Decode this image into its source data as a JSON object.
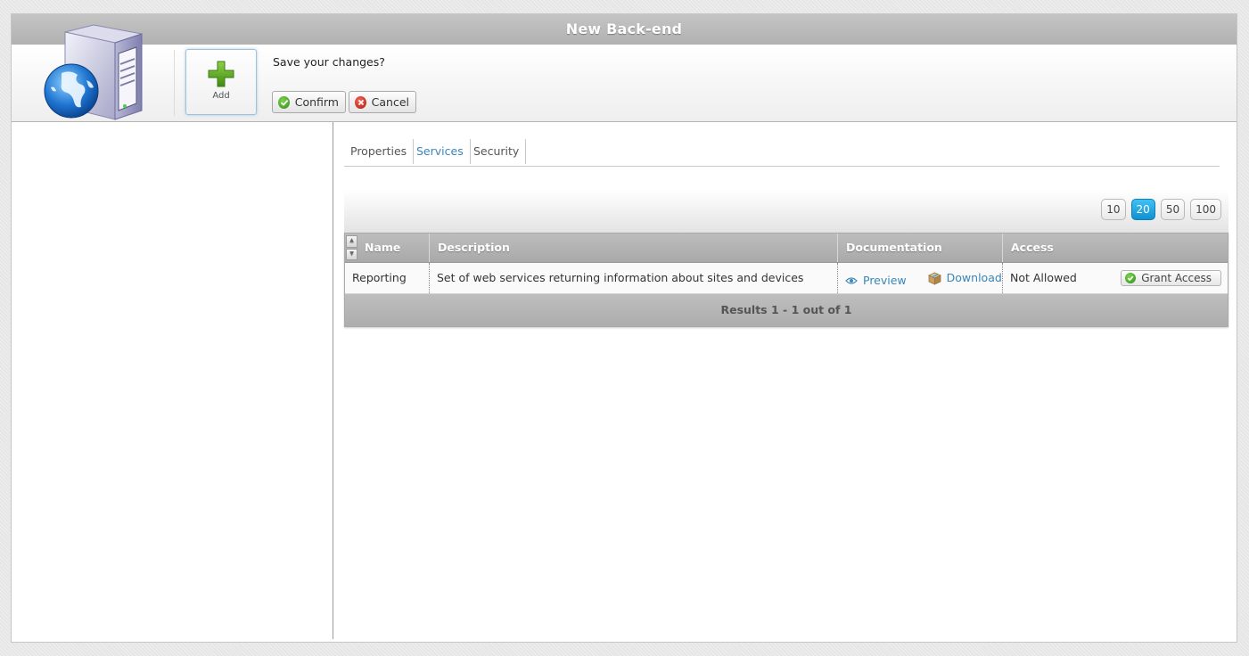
{
  "window": {
    "title": "New Back-end"
  },
  "toolbar": {
    "add_label": "Add",
    "prompt": "Save your changes?",
    "confirm_label": "Confirm",
    "cancel_label": "Cancel"
  },
  "tabs": [
    {
      "label": "Properties",
      "active": false
    },
    {
      "label": "Services",
      "active": true
    },
    {
      "label": "Security",
      "active": false
    }
  ],
  "pager": {
    "options": [
      "10",
      "20",
      "50",
      "100"
    ],
    "selected": "20"
  },
  "grid": {
    "columns": [
      "Name",
      "Description",
      "Documentation",
      "Access"
    ],
    "rows": [
      {
        "name": "Reporting",
        "description": "Set of web services returning information about sites and devices",
        "preview_label": "Preview",
        "download_label": "Download",
        "access": "Not Allowed",
        "grant_label": "Grant Access"
      }
    ],
    "footer": "Results 1 - 1 out of 1"
  },
  "colors": {
    "accent": "#3a86b8",
    "pager_selected": "#1ba3e2",
    "confirm": "#3c9e1f",
    "cancel": "#c0210f"
  },
  "icons": [
    "server-globe-logo",
    "add-plus-icon",
    "confirm-check-icon",
    "cancel-x-icon",
    "preview-eye-icon",
    "download-package-icon",
    "grant-check-icon"
  ]
}
